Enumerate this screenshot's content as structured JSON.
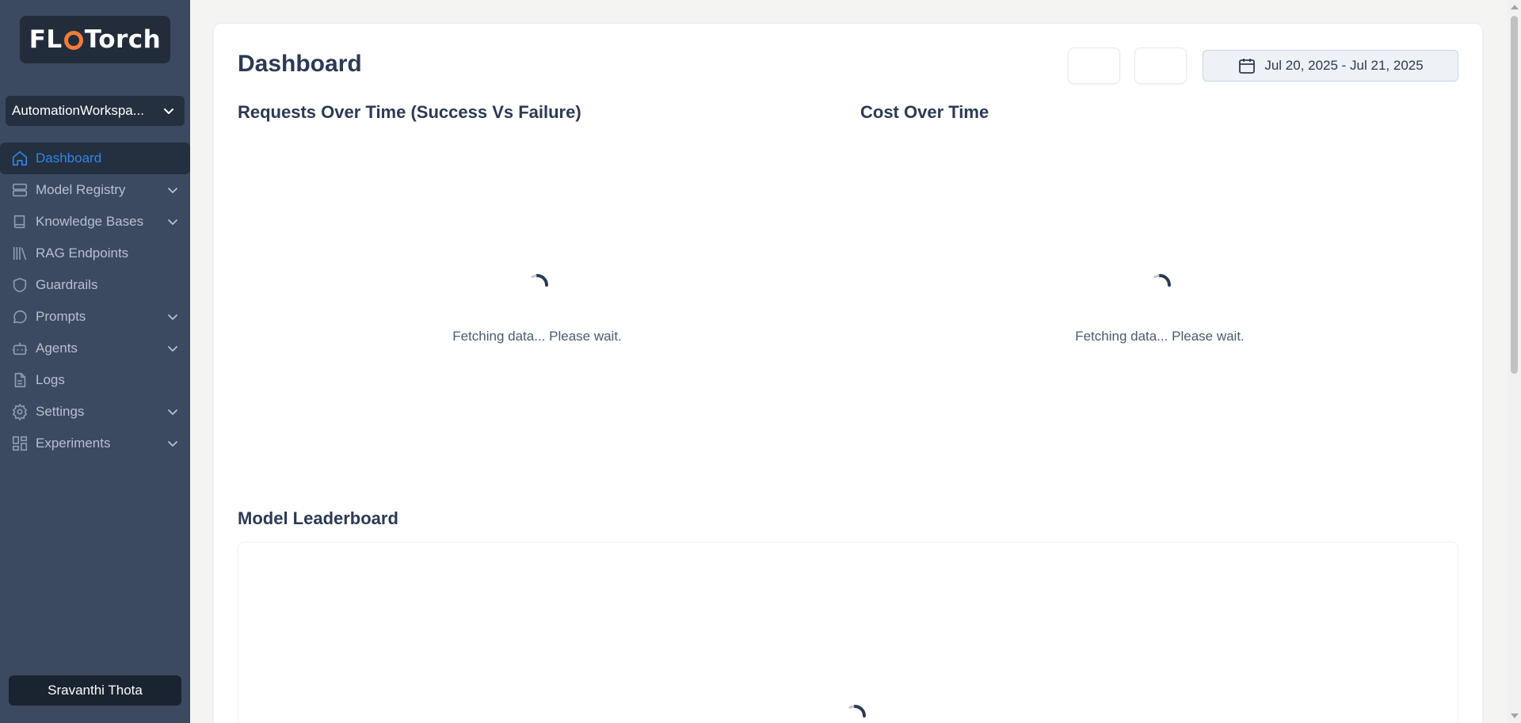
{
  "brand": {
    "logo_left": "FL",
    "logo_right": "Torch"
  },
  "workspace": {
    "label": "AutomationWorkspa..."
  },
  "sidebar": {
    "items": [
      {
        "label": "Dashboard",
        "icon": "home-icon",
        "active": true,
        "expandable": false
      },
      {
        "label": "Model Registry",
        "icon": "server-icon",
        "active": false,
        "expandable": true
      },
      {
        "label": "Knowledge Bases",
        "icon": "book-icon",
        "active": false,
        "expandable": true
      },
      {
        "label": "RAG Endpoints",
        "icon": "library-icon",
        "active": false,
        "expandable": false
      },
      {
        "label": "Guardrails",
        "icon": "shield-icon",
        "active": false,
        "expandable": false
      },
      {
        "label": "Prompts",
        "icon": "message-icon",
        "active": false,
        "expandable": true
      },
      {
        "label": "Agents",
        "icon": "bot-icon",
        "active": false,
        "expandable": true
      },
      {
        "label": "Logs",
        "icon": "file-icon",
        "active": false,
        "expandable": false
      },
      {
        "label": "Settings",
        "icon": "gear-icon",
        "active": false,
        "expandable": true
      },
      {
        "label": "Experiments",
        "icon": "dashboard-grid-icon",
        "active": false,
        "expandable": true
      }
    ]
  },
  "user": {
    "name": "Sravanthi Thota"
  },
  "header": {
    "title": "Dashboard",
    "date_range": "Jul 20, 2025 - Jul 21, 2025"
  },
  "sections": {
    "requests": {
      "title": "Requests Over Time (Success Vs Failure)",
      "loading": "Fetching data... Please wait."
    },
    "cost": {
      "title": "Cost Over Time",
      "loading": "Fetching data... Please wait."
    },
    "leaderboard": {
      "title": "Model Leaderboard"
    }
  },
  "colors": {
    "sidebar_bg": "#3b4a60",
    "active_accent": "#2f86ea",
    "logo_accent": "#f07d3a"
  }
}
